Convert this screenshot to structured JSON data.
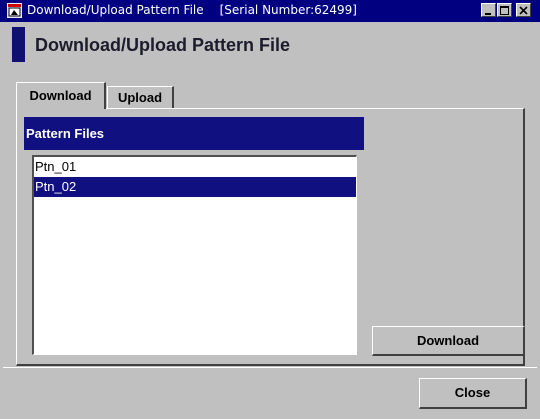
{
  "window": {
    "title": "Download/Upload Pattern File",
    "serial": "[Serial Number:62499]",
    "app_icon": "application-icon",
    "controls": [
      "minimize-icon",
      "maximize-icon",
      "close-icon"
    ]
  },
  "header": {
    "title": "Download/Upload Pattern File"
  },
  "tabs": [
    {
      "label": "Download",
      "active": true
    },
    {
      "label": "Upload",
      "active": false
    }
  ],
  "panel": {
    "header": "Pattern Files",
    "files": [
      {
        "name": "Ptn_01",
        "selected": false
      },
      {
        "name": "Ptn_02",
        "selected": true
      }
    ],
    "download_button": "Download"
  },
  "footer": {
    "close_button": "Close"
  },
  "colors": {
    "titlebar": "#000080",
    "accent": "#101080",
    "face": "#c0c0c0"
  }
}
